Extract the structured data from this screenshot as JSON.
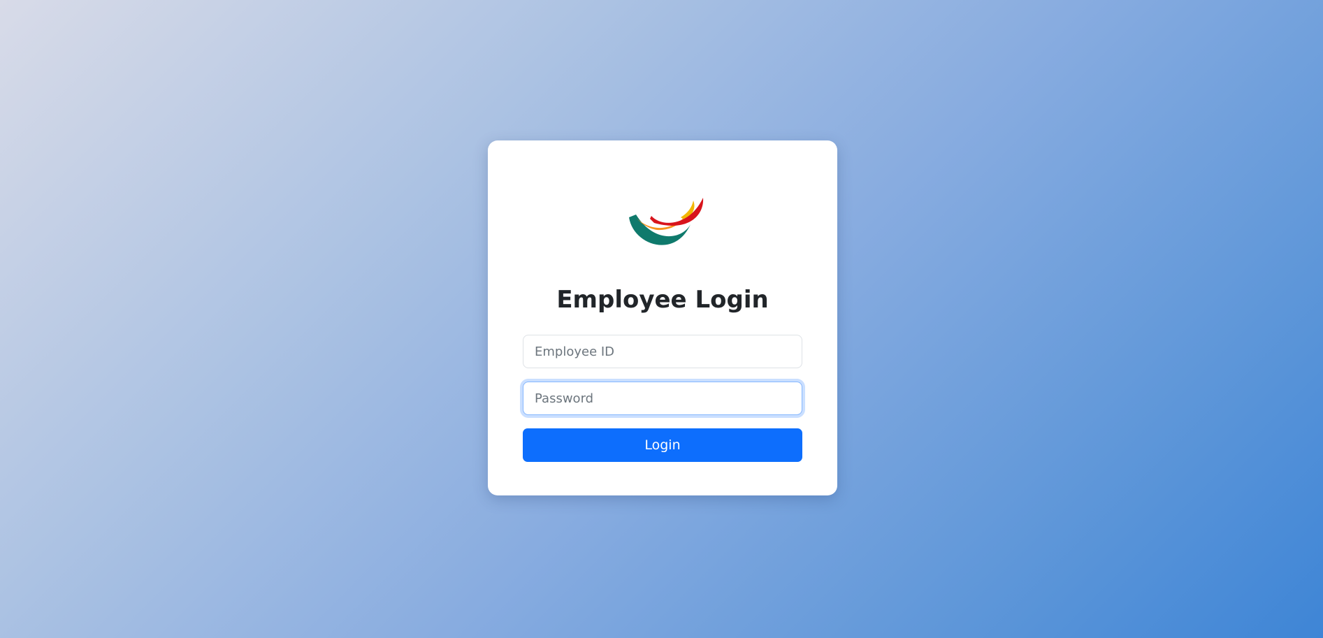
{
  "login": {
    "title": "Employee Login",
    "employee_id_placeholder": "Employee ID",
    "password_placeholder": "Password",
    "login_label": "Login"
  },
  "logo": {
    "name": "company-logo-icon",
    "colors": {
      "teal": "#0f7a6c",
      "orange": "#f7941d",
      "red": "#d8141c",
      "yellow": "#f2b705"
    }
  },
  "colors": {
    "primary": "#0d6efd",
    "focus_ring": "#86b7fe",
    "card": "#ffffff",
    "heading": "#212529",
    "placeholder": "#6c757d"
  }
}
